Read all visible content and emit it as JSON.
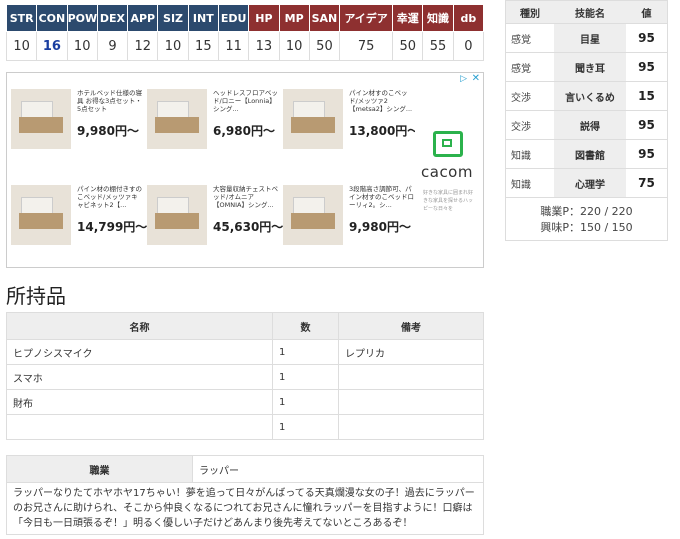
{
  "stats": {
    "headers": [
      {
        "label": "STR",
        "color": "blue"
      },
      {
        "label": "CON",
        "color": "blue"
      },
      {
        "label": "POW",
        "color": "blue"
      },
      {
        "label": "DEX",
        "color": "blue"
      },
      {
        "label": "APP",
        "color": "blue"
      },
      {
        "label": "SIZ",
        "color": "blue"
      },
      {
        "label": "INT",
        "color": "blue"
      },
      {
        "label": "EDU",
        "color": "blue"
      },
      {
        "label": "HP",
        "color": "red"
      },
      {
        "label": "MP",
        "color": "red"
      },
      {
        "label": "SAN",
        "color": "red"
      },
      {
        "label": "アイデア",
        "color": "red"
      },
      {
        "label": "幸運",
        "color": "red"
      },
      {
        "label": "知識",
        "color": "red"
      },
      {
        "label": "db",
        "color": "red"
      }
    ],
    "values": [
      "10",
      "16",
      "10",
      "9",
      "12",
      "10",
      "15",
      "11",
      "13",
      "10",
      "50",
      "75",
      "50",
      "55",
      "0"
    ],
    "highlight_index": 1,
    "colors": {
      "blue": "#2c4a6e",
      "red": "#8e3030",
      "highlight": "#1a3ea0"
    }
  },
  "ad": {
    "adchoice_icon": "adchoices-icon",
    "close_icon": "close-icon",
    "items": [
      {
        "title": "ホテルベッド仕様の寝具 お得な3点セット・5点セット",
        "price": "9,980円〜"
      },
      {
        "title": "ヘッドレスフロアベッド/ロニー【Lonnia】シング...",
        "price": "6,980円〜"
      },
      {
        "title": "パイン材すのこベッド/メッツァ2【metsa2】シング...",
        "price": "13,800円〜"
      },
      {
        "title": "パイン材の棚付きすのこベッド/メッツァキャビネット2【...",
        "price": "14,799円〜"
      },
      {
        "title": "大容量収納チェストベッド/オムニア【OMNIA】シング...",
        "price": "45,630円〜"
      },
      {
        "title": "3段階高さ調節可、パイン材すのこベッドローリィ2。シ...",
        "price": "9,980円〜"
      }
    ],
    "brand": {
      "name": "cacom",
      "sub": "好きな家具に囲まれ好きな家具を探せるハッピーな日々を"
    }
  },
  "skills": {
    "headers": [
      "種別",
      "技能名",
      "値"
    ],
    "rows": [
      {
        "category": "感覚",
        "name": "目星",
        "value": "95"
      },
      {
        "category": "感覚",
        "name": "聞き耳",
        "value": "95"
      },
      {
        "category": "交渉",
        "name": "言いくるめ",
        "value": "15"
      },
      {
        "category": "交渉",
        "name": "説得",
        "value": "95"
      },
      {
        "category": "知識",
        "name": "図書館",
        "value": "95"
      },
      {
        "category": "知識",
        "name": "心理学",
        "value": "75"
      }
    ],
    "job_points": "職業P：220 / 220",
    "interest_points": "興味P：150 / 150"
  },
  "inventory": {
    "title": "所持品",
    "headers": [
      "名称",
      "数",
      "備考"
    ],
    "rows": [
      {
        "name": "ヒプノシスマイク",
        "qty": "1",
        "note": "レプリカ"
      },
      {
        "name": "スマホ",
        "qty": "1",
        "note": ""
      },
      {
        "name": "財布",
        "qty": "1",
        "note": ""
      },
      {
        "name": "",
        "qty": "1",
        "note": ""
      }
    ]
  },
  "profile": {
    "job_label": "職業",
    "job_value": "ラッパー",
    "description": "ラッパーなりたてホヤホヤ17ちゃい！夢を追って日々がんばってる天真爛漫な女の子！過去にラッパーのお兄さんに助けられ、そこから仲良くなるにつれてお兄さんに憧れラッパーを目指すように！口癖は「今日も一日頑張るぞ！」明るく優しい子だけどあんまり後先考えてないところあるぞ！"
  }
}
